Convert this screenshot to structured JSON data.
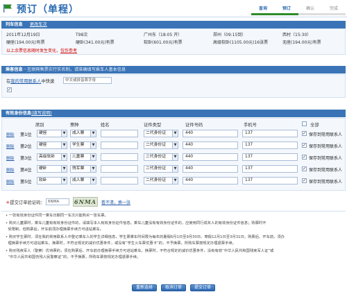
{
  "header": {
    "title": "预订（单程）",
    "steps": [
      "查询",
      "预订",
      "确认",
      "完成"
    ],
    "active_step": "预订"
  },
  "train_section": {
    "title": "列车信息",
    "change_link": "更改车次",
    "date": "2011年12月19日",
    "train_no": "T98次",
    "from": "广州东（18:05 开）",
    "via": "郑州（09:15到）",
    "to": "西村（15:30）",
    "fares": [
      "硬座(194.00元)有票",
      "硬卧(341.00元)有票",
      "软卧(601.00元)有票",
      "高级软卧(1105.00元)16张票",
      "无座(194.00元)有票"
    ],
    "notice_red": "以上余票信息随时发生变化，",
    "notice_red_link": "仅作参考"
  },
  "passenger_section": {
    "title": "乘客信息",
    "subtitle": "－互联网售票实行实名制，请准确填写乘车人基本信息",
    "label_prefix": "在",
    "label_link": "我的常用联系人",
    "label_suffix": "中快速",
    "search_placeholder": "中文或拼音首字母"
  },
  "id_section": {
    "title": "有效身份信息",
    "help_link": "(填写说明)",
    "columns": [
      "席别",
      "票种",
      "姓名",
      "证件类型",
      "证件号码",
      "手机号",
      "全部"
    ],
    "delete_label": "删除",
    "keep_label": "保存到常用联系人",
    "rows": [
      {
        "order": "第1位",
        "seat": "硬座",
        "ticket": "成人票",
        "name": "",
        "id_type": "二代身份证",
        "id_no": "440",
        "phone": "137"
      },
      {
        "order": "第2位",
        "seat": "硬座",
        "ticket": "学生票",
        "name": "",
        "id_type": "二代身份证",
        "id_no": "440",
        "phone": "137"
      },
      {
        "order": "第3位",
        "seat": "高级软卧",
        "ticket": "儿童票",
        "name": "",
        "id_type": "二代身份证",
        "id_no": "440",
        "phone": "137"
      },
      {
        "order": "第4位",
        "seat": "硬卧",
        "ticket": "残军票",
        "name": "",
        "id_type": "二代身份证",
        "id_no": "440",
        "phone": "137"
      },
      {
        "order": "第5位",
        "seat": "软卧",
        "ticket": "成人票",
        "name": "",
        "id_type": "二代身份证",
        "id_no": "440",
        "phone": "137"
      }
    ]
  },
  "captcha": {
    "label": "提交订单验证码：",
    "value": "6NMA",
    "image_text": "6NMA",
    "refresh_link": "看不清，换一张"
  },
  "notes": [
    "一张有效身份证件同一乘车日期同一车次只能购买一张车票。",
    "购买儿童票时，乘车儿童有有效身份证件的，请填写本人有效身份证件信息。乘车儿童没有有效身份证件的，应使用同行成年人的有效身份证件信息；购票时不",
    "受限制，但购票后，开车前须办理换票手续方可进站乘车。",
    "购买学生票时，须在我的常用联系人中登记乘车人的学生详细信息，学生票乘车时间限为每年的暑假6月1日至9月30日、寒假12月1日至3月31日。购票后、开车前，须办",
    "理换票手续方可进站乘车，换票时，不符合规定的减价优惠条件，或没有“学生火车票优惠卡”的，不予换票，所购车票按规定办理退票手续。",
    "购买残疾军人（警察）优待票的，须在购票后、开车前办理换票手续方可进站乘车。换票时，不符合规定的减价优惠条件，没有有效“中华人民共和国残疾军人证”或",
    "“中华人民共和国伤残人民警察证”的，不予换票，所购车票按规定办理退票手续。"
  ],
  "buttons": {
    "reset": "重新选择",
    "cancel": "取消订单",
    "submit": "提交订单"
  }
}
